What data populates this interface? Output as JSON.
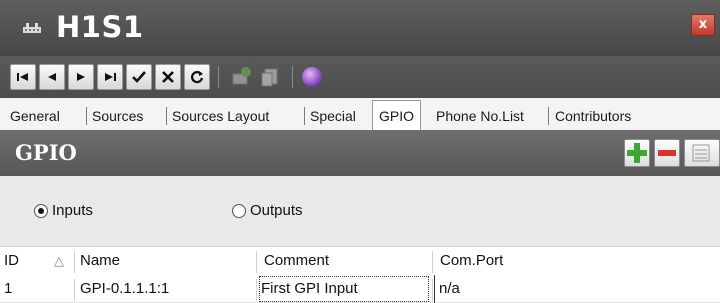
{
  "window": {
    "title": "H1S1",
    "close_label": "x"
  },
  "toolbar": {
    "buttons": [
      "first",
      "previous",
      "next",
      "last",
      "confirm",
      "cancel",
      "refresh"
    ],
    "icons": [
      "first-record-icon",
      "previous-record-icon",
      "next-record-icon",
      "last-record-icon",
      "check-icon",
      "x-icon",
      "refresh-icon",
      "phone-icon",
      "copy-icon",
      "globe-icon"
    ]
  },
  "tabs": [
    {
      "label": "General"
    },
    {
      "label": "Sources"
    },
    {
      "label": "Sources Layout"
    },
    {
      "label": "Special"
    },
    {
      "label": "GPIO",
      "active": true
    },
    {
      "label": "Phone No.List"
    },
    {
      "label": "Contributors"
    }
  ],
  "section": {
    "title": "GPIO"
  },
  "radio": {
    "inputs": "Inputs",
    "outputs": "Outputs",
    "selected": "Inputs"
  },
  "grid": {
    "columns": [
      "ID",
      "Name",
      "Comment",
      "Com.Port"
    ],
    "sort_glyph": "△",
    "rows": [
      {
        "id": "1",
        "name": "GPI-0.1.1.1:1",
        "comment": "First GPI Input",
        "com_port": "n/a"
      }
    ]
  },
  "colors": {
    "accent_add": "#3fa535",
    "accent_remove": "#d9342b",
    "header_bg": "#555555"
  }
}
